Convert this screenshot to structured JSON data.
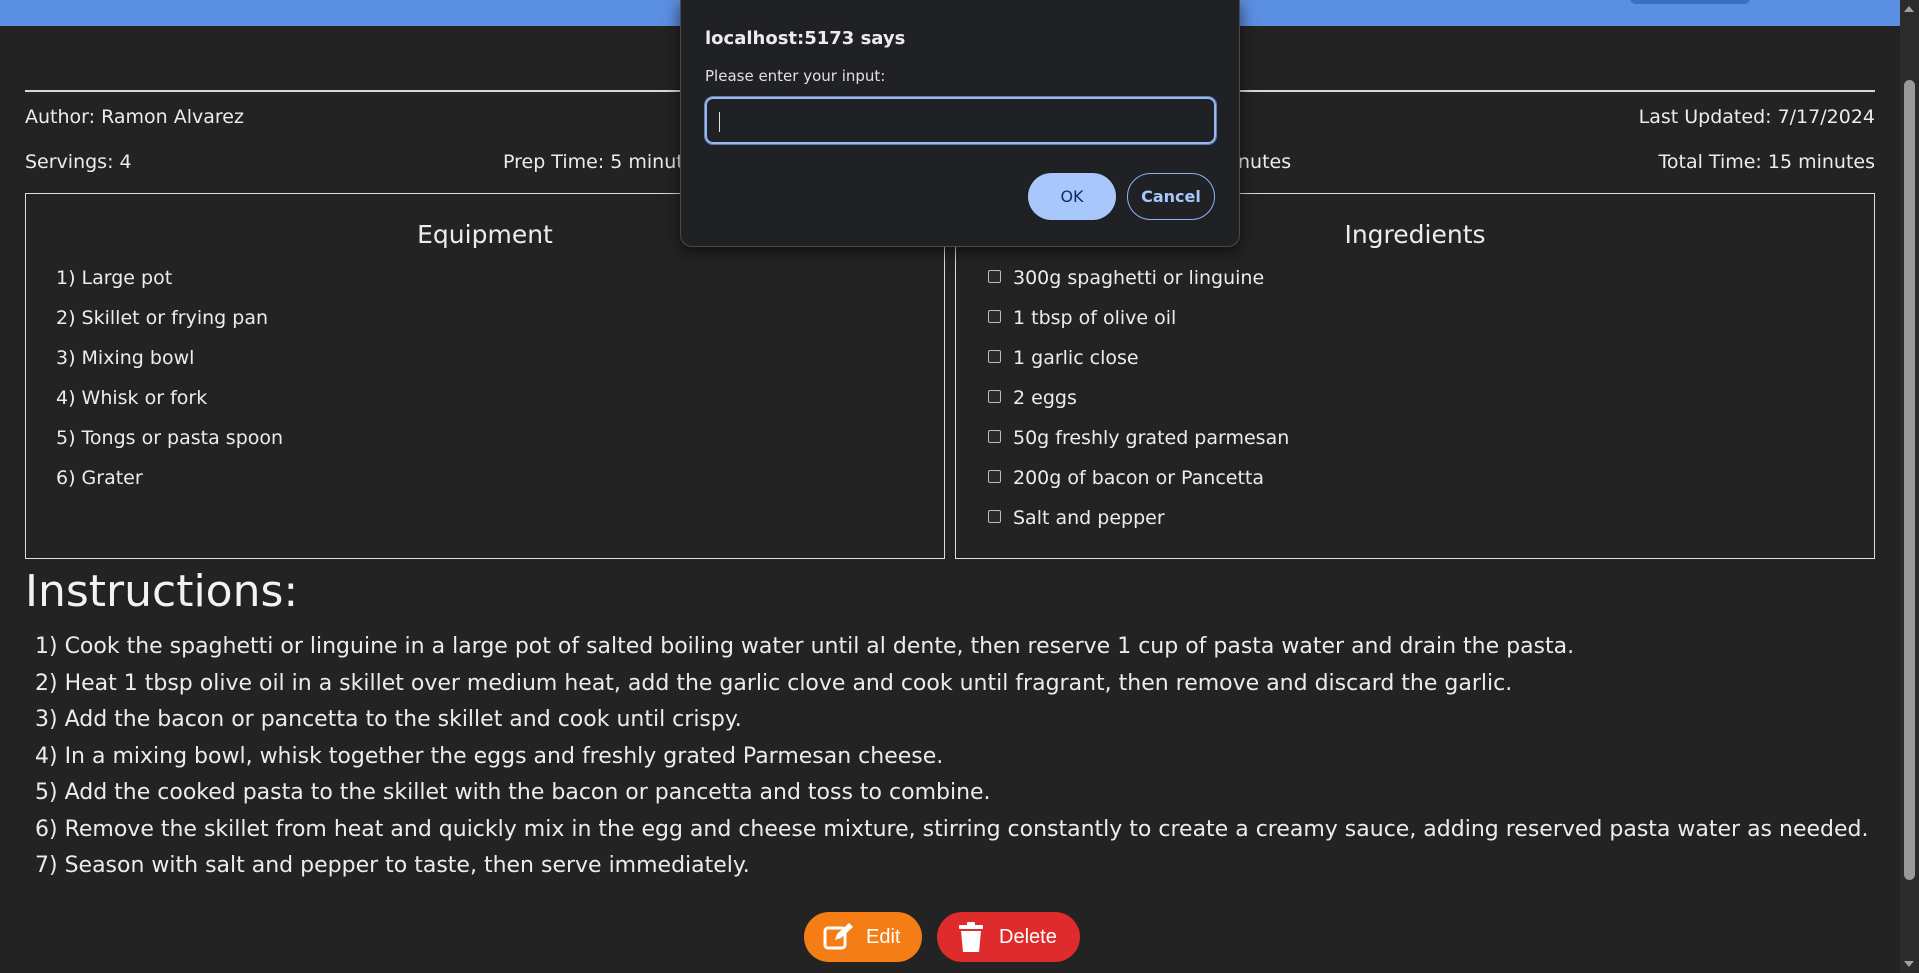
{
  "dialog": {
    "title": "localhost:5173 says",
    "message": "Please enter your input:",
    "input_value": "",
    "ok_label": "OK",
    "cancel_label": "Cancel"
  },
  "recipe": {
    "author": "Author: Ramon Alvarez",
    "last_updated": "Last Updated: 7/17/2024",
    "servings": "Servings: 4",
    "prep_time": "Prep Time: 5 minut",
    "cook_time_fragment": "nutes",
    "total_time": "Total Time: 15 minutes"
  },
  "equipment": {
    "title": "Equipment",
    "items": [
      "1) Large pot",
      "2) Skillet or frying pan",
      "3) Mixing bowl",
      "4) Whisk or fork",
      "5) Tongs or pasta spoon",
      "6) Grater"
    ]
  },
  "ingredients": {
    "title": "Ingredients",
    "items": [
      "300g spaghetti or linguine",
      "1 tbsp of olive oil",
      "1 garlic close",
      "2 eggs",
      "50g freshly grated parmesan",
      "200g of bacon or Pancetta",
      "Salt and pepper"
    ]
  },
  "instructions": {
    "title": "Instructions:",
    "steps": [
      "1) Cook the spaghetti or linguine in a large pot of salted boiling water until al dente, then reserve 1 cup of pasta water and drain the pasta.",
      "2) Heat 1 tbsp olive oil in a skillet over medium heat, add the garlic clove and cook until fragrant, then remove and discard the garlic.",
      "3) Add the bacon or pancetta to the skillet and cook until crispy.",
      "4) In a mixing bowl, whisk together the eggs and freshly grated Parmesan cheese.",
      "5) Add the cooked pasta to the skillet with the bacon or pancetta and toss to combine.",
      "6) Remove the skillet from heat and quickly mix in the egg and cheese mixture, stirring constantly to create a creamy sauce, adding reserved pasta water as needed.",
      "7) Season with salt and pepper to taste, then serve immediately."
    ]
  },
  "actions": {
    "edit_label": "Edit",
    "delete_label": "Delete"
  },
  "colors": {
    "top_bar": "#5b8fe1",
    "edit": "#f57d15",
    "delete": "#df2b2b",
    "dialog_ok": "#a8c7fa"
  },
  "icons": {
    "edit": "edit-icon",
    "delete": "trash-icon"
  }
}
